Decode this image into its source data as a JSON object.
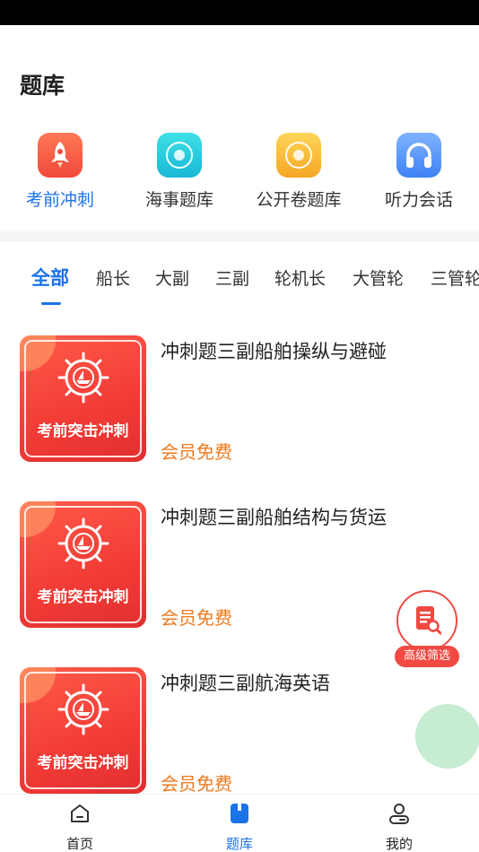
{
  "header": {
    "title": "题库"
  },
  "quick_entries": [
    {
      "label": "考前冲刺",
      "icon": "rocket-icon",
      "active": true,
      "color": "#f0483c"
    },
    {
      "label": "海事题库",
      "icon": "maritime-emblem-icon",
      "active": false,
      "color": "#18b8d6"
    },
    {
      "label": "公开卷题库",
      "icon": "maritime-emblem-icon",
      "active": false,
      "color": "#f5a623"
    },
    {
      "label": "听力会话",
      "icon": "headphones-icon",
      "active": false,
      "color": "#3f82f5"
    }
  ],
  "tabs": [
    {
      "label": "全部",
      "active": true
    },
    {
      "label": "船长",
      "active": false
    },
    {
      "label": "大副",
      "active": false
    },
    {
      "label": "三副",
      "active": false
    },
    {
      "label": "轮机长",
      "active": false
    },
    {
      "label": "大管轮",
      "active": false
    },
    {
      "label": "三管轮",
      "active": false
    }
  ],
  "cards": [
    {
      "thumb_text": "考前突击冲刺",
      "title": "冲刺题三副船舶操纵与避碰",
      "price": "会员免费"
    },
    {
      "thumb_text": "考前突击冲刺",
      "title": "冲刺题三副船舶结构与货运",
      "price": "会员免费"
    },
    {
      "thumb_text": "考前突击冲刺",
      "title": "冲刺题三副航海英语",
      "price": "会员免费"
    }
  ],
  "filter_button": {
    "label": "高级筛选",
    "icon": "document-search-icon"
  },
  "bottom_nav": [
    {
      "label": "首页",
      "icon": "home-icon",
      "active": false
    },
    {
      "label": "题库",
      "icon": "question-bank-icon",
      "active": true
    },
    {
      "label": "我的",
      "icon": "user-icon",
      "active": false
    }
  ],
  "colors": {
    "accent": "#1a73e8",
    "price": "#f07a1e",
    "thumb": "#f23b36"
  }
}
